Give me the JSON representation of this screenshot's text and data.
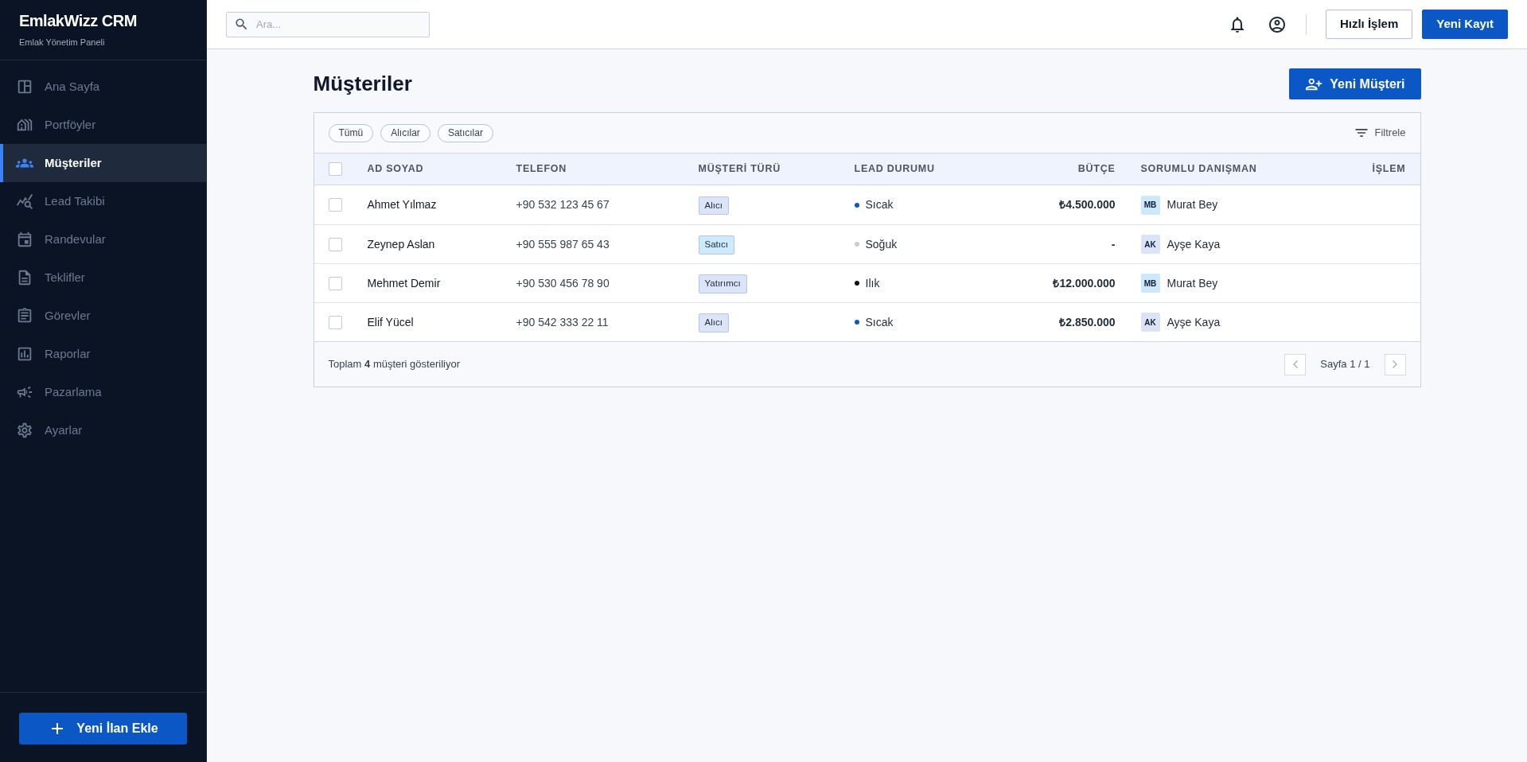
{
  "sidebar": {
    "brand": "EmlakWizz CRM",
    "subtitle": "Emlak Yönetim Paneli",
    "items": [
      {
        "label": "Ana Sayfa",
        "selected": false
      },
      {
        "label": "Portföyler",
        "selected": false
      },
      {
        "label": "Müşteriler",
        "selected": true
      },
      {
        "label": "Lead Takibi",
        "selected": false
      },
      {
        "label": "Randevular",
        "selected": false
      },
      {
        "label": "Teklifler",
        "selected": false
      },
      {
        "label": "Görevler",
        "selected": false
      },
      {
        "label": "Raporlar",
        "selected": false
      },
      {
        "label": "Pazarlama",
        "selected": false
      },
      {
        "label": "Ayarlar",
        "selected": false
      }
    ],
    "add_button": "Yeni İlan Ekle"
  },
  "topbar": {
    "search": {
      "placeholder": "Ara..."
    },
    "buttons": [
      {
        "label": "Hızlı İşlem",
        "kind": "outline"
      },
      {
        "label": "Yeni Kayıt",
        "kind": "primary"
      }
    ]
  },
  "page": {
    "title": "Müşteriler",
    "new_button": "Yeni Müşteri"
  },
  "filters": {
    "chips": [
      {
        "label": "Tümü",
        "selected": false
      },
      {
        "label": "Alıcılar",
        "selected": false
      },
      {
        "label": "Satıcılar",
        "selected": false
      }
    ],
    "filter_button": "Filtrele"
  },
  "table": {
    "select_all": {
      "checked": false
    },
    "columns": [
      "AD SOYAD",
      "TELEFON",
      "MÜŞTERİ TÜRÜ",
      "LEAD DURUMU",
      "BÜTÇE",
      "SORUMLU DANIŞMAN",
      "İŞLEM"
    ],
    "rows": [
      {
        "checked": false,
        "name": "Ahmet Yılmaz",
        "phone": "+90 532 123 45 67",
        "type": {
          "label": "Alıcı",
          "color": "#dbe4f8"
        },
        "lead": {
          "label": "Sıcak",
          "color": "#0b57c5"
        },
        "budget": "₺4.500.000",
        "consultant": {
          "initials": "MB",
          "name": "Murat Bey",
          "color": "#cde7fb"
        }
      },
      {
        "checked": false,
        "name": "Zeynep Aslan",
        "phone": "+90 555 987 65 43",
        "type": {
          "label": "Satıcı",
          "color": "#cdeafc"
        },
        "lead": {
          "label": "Soğuk",
          "color": "#c8ccd2"
        },
        "budget": "-",
        "consultant": {
          "initials": "AK",
          "name": "Ayşe Kaya",
          "color": "#dae3f8"
        }
      },
      {
        "checked": false,
        "name": "Mehmet Demir",
        "phone": "+90 530 456 78 90",
        "type": {
          "label": "Yatırımcı",
          "color": "#dbe4f8"
        },
        "lead": {
          "label": "Ilık",
          "color": "#0b1424"
        },
        "budget": "₺12.000.000",
        "consultant": {
          "initials": "MB",
          "name": "Murat Bey",
          "color": "#cde7fb"
        }
      },
      {
        "checked": false,
        "name": "Elif Yücel",
        "phone": "+90 542 333 22 11",
        "type": {
          "label": "Alıcı",
          "color": "#dbe4f8"
        },
        "lead": {
          "label": "Sıcak",
          "color": "#0b57c5"
        },
        "budget": "₺2.850.000",
        "consultant": {
          "initials": "AK",
          "name": "Ayşe Kaya",
          "color": "#dae3f8"
        }
      }
    ]
  },
  "footer": {
    "summary": "Toplam **4** müşteri gösteriliyor",
    "page_label": "Sayfa 1 / 1",
    "prev": {
      "disabled": true
    },
    "next": {
      "disabled": true
    }
  }
}
